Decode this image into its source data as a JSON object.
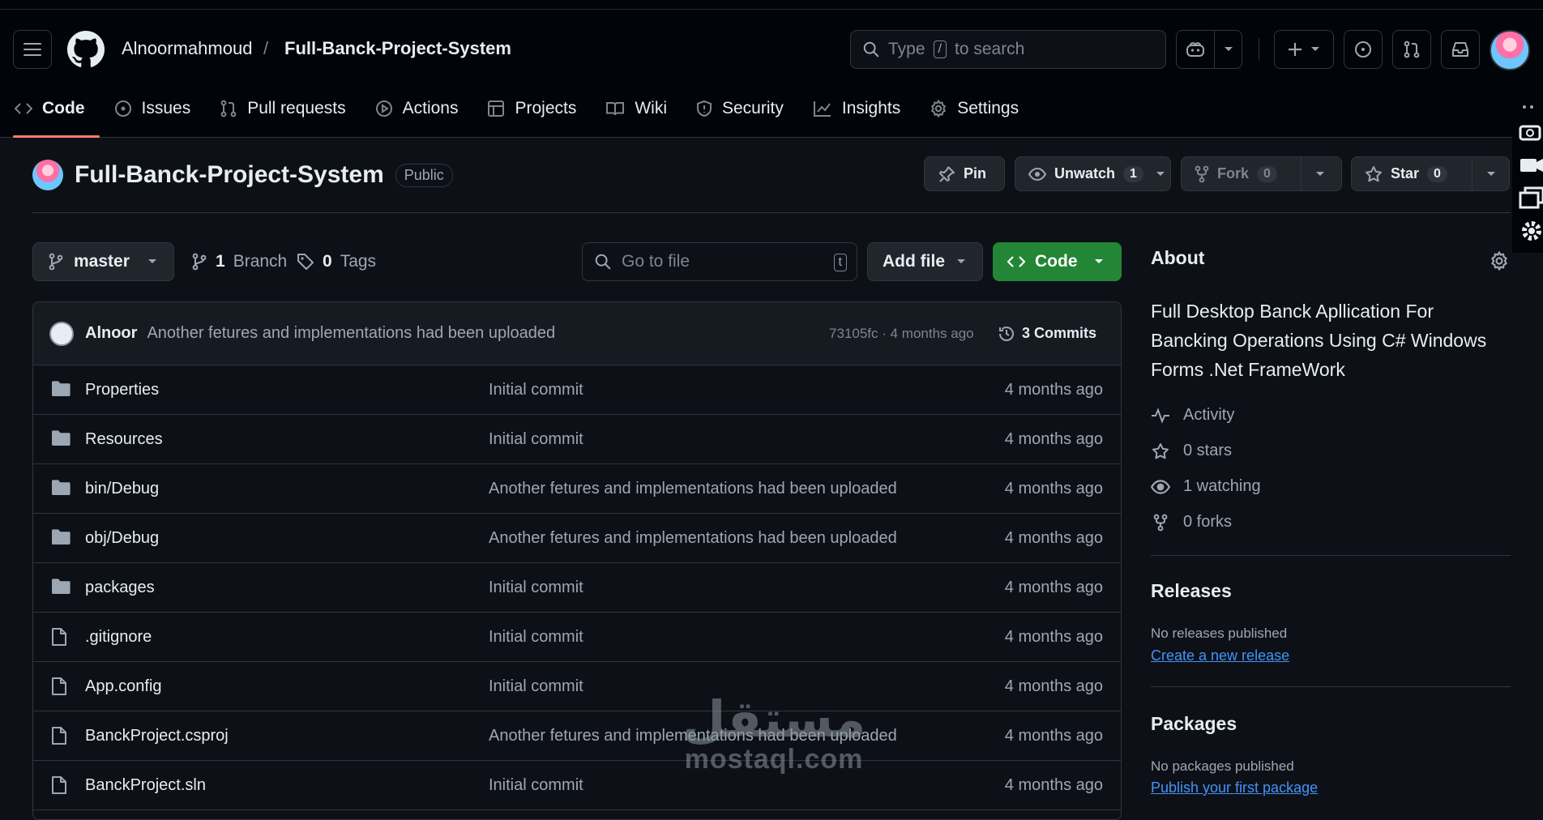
{
  "header": {
    "owner": "Alnoormahmoud",
    "separator": "/",
    "repo": "Full-Banck-Project-System",
    "search_text_before": "Type",
    "search_key": "/",
    "search_text_after": "to search"
  },
  "nav": {
    "tabs": [
      {
        "label": "Code",
        "icon": "code-icon"
      },
      {
        "label": "Issues",
        "icon": "issue-icon"
      },
      {
        "label": "Pull requests",
        "icon": "pull-request-icon"
      },
      {
        "label": "Actions",
        "icon": "play-icon"
      },
      {
        "label": "Projects",
        "icon": "table-icon"
      },
      {
        "label": "Wiki",
        "icon": "book-icon"
      },
      {
        "label": "Security",
        "icon": "shield-icon"
      },
      {
        "label": "Insights",
        "icon": "graph-icon"
      },
      {
        "label": "Settings",
        "icon": "gear-icon"
      }
    ]
  },
  "repo": {
    "name": "Full-Banck-Project-System",
    "visibility": "Public",
    "pin_label": "Pin",
    "unwatch_label": "Unwatch",
    "watch_count": "1",
    "fork_label": "Fork",
    "fork_count": "0",
    "star_label": "Star",
    "star_count": "0"
  },
  "toolbar": {
    "branch": "master",
    "branch_count": "1",
    "branch_word": "Branch",
    "tag_count": "0",
    "tag_word": "Tags",
    "gofile_placeholder": "Go to file",
    "gofile_key": "t",
    "addfile_label": "Add file",
    "code_label": "Code"
  },
  "commit": {
    "author": "Alnoor",
    "message": "Another fetures and implementations had been uploaded",
    "hash_age": "73105fc · 4 months ago",
    "commits": "3 Commits"
  },
  "files": [
    {
      "type": "folder",
      "name": "Properties",
      "message": "Initial commit",
      "age": "4 months ago"
    },
    {
      "type": "folder",
      "name": "Resources",
      "message": "Initial commit",
      "age": "4 months ago"
    },
    {
      "type": "folder",
      "name": "bin/Debug",
      "message": "Another fetures and implementations had been uploaded",
      "age": "4 months ago"
    },
    {
      "type": "folder",
      "name": "obj/Debug",
      "message": "Another fetures and implementations had been uploaded",
      "age": "4 months ago"
    },
    {
      "type": "folder",
      "name": "packages",
      "message": "Initial commit",
      "age": "4 months ago"
    },
    {
      "type": "file",
      "name": ".gitignore",
      "message": "Initial commit",
      "age": "4 months ago"
    },
    {
      "type": "file",
      "name": "App.config",
      "message": "Initial commit",
      "age": "4 months ago"
    },
    {
      "type": "file",
      "name": "BanckProject.csproj",
      "message": "Another fetures and implementations had been uploaded",
      "age": "4 months ago"
    },
    {
      "type": "file",
      "name": "BanckProject.sln",
      "message": "Initial commit",
      "age": "4 months ago"
    }
  ],
  "about": {
    "title": "About",
    "description": "Full Desktop Banck Apllication For Bancking Operations Using C# Windows Forms .Net FrameWork",
    "activity": "Activity",
    "stars": "0 stars",
    "watching": "1 watching",
    "forks": "0 forks",
    "releases_title": "Releases",
    "releases_none": "No releases published",
    "releases_link": "Create a new release",
    "packages_title": "Packages",
    "packages_none": "No packages published",
    "packages_link": "Publish your first package"
  },
  "watermark": {
    "arabic": "مستقل",
    "latin": "mostaql.com"
  },
  "colors": {
    "background": "#0d1117",
    "header": "#010409",
    "border": "#30363d",
    "accent_green": "#238636",
    "link_blue": "#4493f8",
    "tab_underline": "#f78166"
  }
}
